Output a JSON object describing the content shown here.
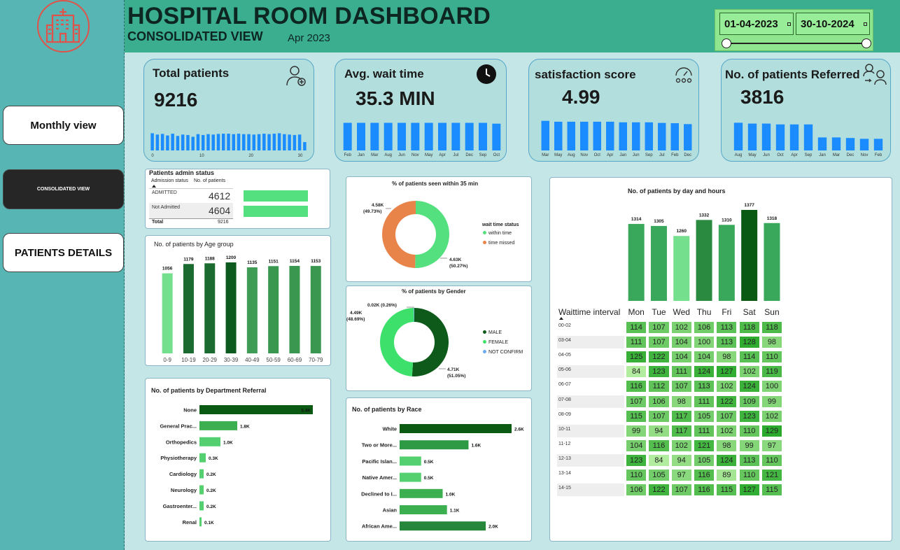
{
  "header": {
    "title": "HOSPITAL ROOM DASHBOARD",
    "subtitle": "CONSOLIDATED VIEW",
    "month": "Apr 2023",
    "date_from": "01-04-2023",
    "date_to": "30-10-2024"
  },
  "nav": [
    {
      "label": "Monthly view"
    },
    {
      "label": "CONSOLIDATED VIEW"
    },
    {
      "label": "PATIENTS DETAILS"
    }
  ],
  "kpis": {
    "total": {
      "title": "Total patients",
      "value": "9216",
      "ticks": [
        "0",
        "10",
        "20",
        "30"
      ],
      "bars": [
        0.78,
        0.72,
        0.75,
        0.68,
        0.76,
        0.66,
        0.72,
        0.7,
        0.62,
        0.74,
        0.7,
        0.74,
        0.72,
        0.75,
        0.76,
        0.76,
        0.74,
        0.76,
        0.74,
        0.74,
        0.72,
        0.74,
        0.76,
        0.74,
        0.76,
        0.78,
        0.74,
        0.72,
        0.7,
        0.72,
        0.38
      ]
    },
    "wait": {
      "title": "Avg. wait time",
      "value": "35.3 MIN",
      "labels": [
        "Feb",
        "Jan",
        "Mar",
        "Aug",
        "Jun",
        "Nov",
        "May",
        "Apr",
        "Jul",
        "Dec",
        "Sep",
        "Oct"
      ],
      "bars": [
        1,
        1,
        1,
        1,
        1,
        1,
        1,
        1,
        1,
        1,
        1,
        0.97
      ]
    },
    "satisfaction": {
      "title": "satisfaction score",
      "value": "4.99",
      "labels": [
        "Mar",
        "May",
        "Aug",
        "Nov",
        "Oct",
        "Apr",
        "Jan",
        "Jun",
        "Sep",
        "Jul",
        "Feb",
        "Dec"
      ],
      "bars": [
        1,
        0.97,
        0.97,
        0.97,
        0.97,
        0.97,
        0.95,
        0.95,
        0.95,
        0.93,
        0.92,
        0.89
      ]
    },
    "referred": {
      "title": "No. of patients Referred",
      "value": "3816",
      "labels": [
        "Aug",
        "May",
        "Jun",
        "Oct",
        "Apr",
        "Sep",
        "Jan",
        "Mar",
        "Dec",
        "Nov",
        "Feb"
      ],
      "bars": [
        1,
        0.97,
        0.97,
        0.94,
        0.94,
        0.94,
        0.47,
        0.47,
        0.45,
        0.42,
        0.42
      ]
    }
  },
  "admin_status": {
    "title": "Patients admin status",
    "col1": "Admission status",
    "col2": "No. of patients",
    "rows": [
      {
        "label": "ADMITTED",
        "value": "4612",
        "share": 1.0
      },
      {
        "label": "Not Admitted",
        "value": "4604",
        "share": 0.998
      }
    ],
    "total_label": "Total",
    "total": "9216"
  },
  "age_chart": {
    "title": "No. of patients by Age group",
    "categories": [
      "0-9",
      "10-19",
      "20-29",
      "30-39",
      "40-49",
      "50-59",
      "60-69",
      "70-79"
    ],
    "values": [
      1056,
      1179,
      1188,
      1200,
      1135,
      1151,
      1154,
      1153
    ],
    "colors": [
      "#74df8d",
      "#1b6b30",
      "#1b6b30",
      "#0c5a1d",
      "#3e9c55",
      "#3a9750",
      "#3a9750",
      "#3a9750"
    ]
  },
  "wait_chart": {
    "title": "% of patients seen within 35 min",
    "legend_title": "wait time status",
    "slices": [
      {
        "name": "within time",
        "value": 50.27,
        "label": "4.63K",
        "pct": "(50.27%)",
        "color": "#55e07f"
      },
      {
        "name": "time missed",
        "value": 49.73,
        "label": "4.58K",
        "pct": "(49.73%)",
        "color": "#e8844a"
      }
    ]
  },
  "gender_chart": {
    "title": "% of patients by Gender",
    "slices": [
      {
        "name": "MALE",
        "value": 51.05,
        "label": "4.71K",
        "pct": "(51.05%)",
        "color": "#0d5a1b"
      },
      {
        "name": "FEMALE",
        "value": 48.69,
        "label": "4.49K",
        "pct": "(48.69%)",
        "color": "#3ee06c"
      },
      {
        "name": "NOT CONFIRM",
        "value": 0.26,
        "label": "0.02K (0.26%)",
        "pct": "",
        "color": "#6aaaf0"
      }
    ]
  },
  "dept_chart": {
    "title": "No. of patients by Department Referral",
    "categories": [
      "None",
      "General Prac...",
      "Orthopedics",
      "Physiotherapy",
      "Cardiology",
      "Neurology",
      "Gastroenter...",
      "Renal"
    ],
    "values": [
      5.4,
      1.8,
      1.0,
      0.3,
      0.2,
      0.2,
      0.2,
      0.1
    ],
    "labels": [
      "5.4K",
      "1.8K",
      "1.0K",
      "0.3K",
      "0.2K",
      "0.2K",
      "0.2K",
      "0.1K"
    ]
  },
  "race_chart": {
    "title": "No. of patients by Race",
    "categories": [
      "White",
      "Two or More...",
      "Pacific Islan...",
      "Native Amer...",
      "Declined to I...",
      "Asian",
      "African Ame..."
    ],
    "values": [
      2.6,
      1.6,
      0.5,
      0.5,
      1.0,
      1.1,
      2.0
    ],
    "labels": [
      "2.6K",
      "1.6K",
      "0.5K",
      "0.5K",
      "1.0K",
      "1.1K",
      "2.0K"
    ]
  },
  "day_chart": {
    "title": "No. of patients by day and hours",
    "header": "Waittime interval",
    "days": [
      "Mon",
      "Tue",
      "Wed",
      "Thu",
      "Fri",
      "Sat",
      "Sun"
    ],
    "totals": [
      1314,
      1305,
      1260,
      1332,
      1310,
      1377,
      1318
    ],
    "rows": [
      {
        "interval": "00-02",
        "values": [
          114,
          107,
          102,
          106,
          113,
          118,
          118
        ]
      },
      {
        "interval": "03-04",
        "values": [
          111,
          107,
          104,
          100,
          113,
          128,
          98
        ]
      },
      {
        "interval": "04-05",
        "values": [
          125,
          122,
          104,
          104,
          98,
          114,
          110
        ]
      },
      {
        "interval": "05-06",
        "values": [
          84,
          123,
          111,
          124,
          127,
          102,
          119
        ]
      },
      {
        "interval": "06-07",
        "values": [
          116,
          112,
          107,
          113,
          102,
          124,
          100
        ]
      },
      {
        "interval": "07-08",
        "values": [
          107,
          106,
          98,
          111,
          122,
          109,
          99
        ]
      },
      {
        "interval": "08-09",
        "values": [
          115,
          107,
          117,
          105,
          107,
          123,
          102
        ]
      },
      {
        "interval": "10-11",
        "values": [
          99,
          94,
          117,
          111,
          102,
          110,
          129
        ]
      },
      {
        "interval": "11-12",
        "values": [
          104,
          116,
          102,
          121,
          98,
          99,
          97
        ]
      },
      {
        "interval": "12-13",
        "values": [
          123,
          84,
          94,
          105,
          124,
          113,
          110
        ]
      },
      {
        "interval": "13-14",
        "values": [
          110,
          105,
          97,
          116,
          89,
          110,
          121
        ]
      },
      {
        "interval": "14-15",
        "values": [
          106,
          122,
          107,
          116,
          115,
          127,
          115
        ]
      }
    ]
  }
}
